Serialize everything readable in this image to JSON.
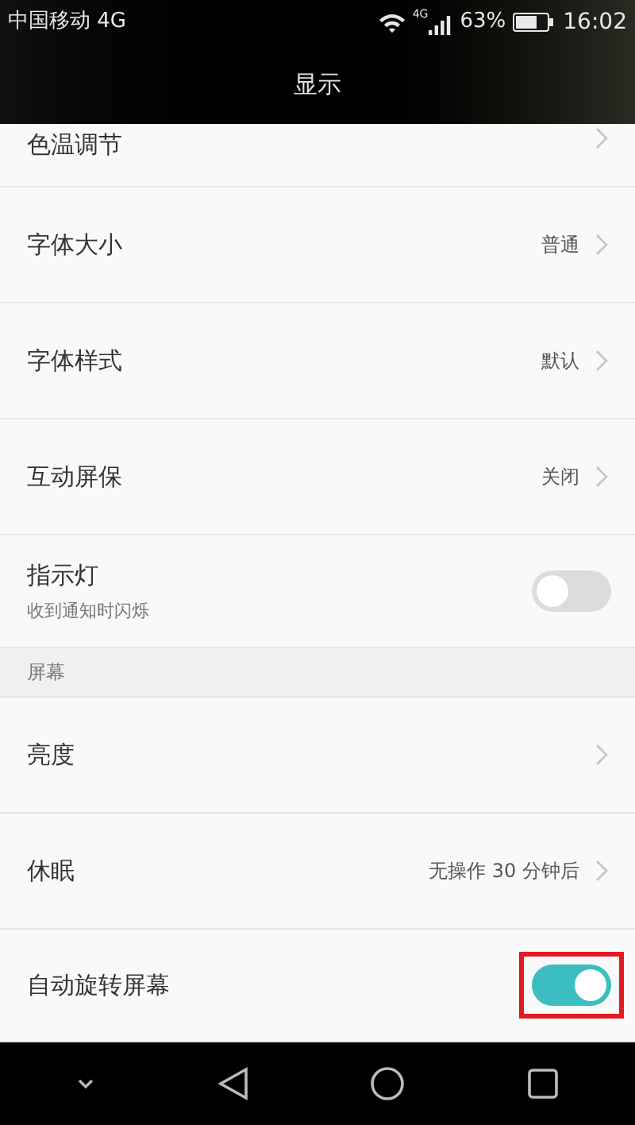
{
  "status_bar": {
    "carrier": "中国移动 4G",
    "network_badge": "4G",
    "battery": "63%",
    "time": "16:02"
  },
  "header": {
    "title": "显示"
  },
  "rows": [
    {
      "kind": "link",
      "label": "色温调节",
      "partial": true
    },
    {
      "kind": "link",
      "label": "字体大小",
      "value": "普通"
    },
    {
      "kind": "link",
      "label": "字体样式",
      "value": "默认"
    },
    {
      "kind": "link",
      "label": "互动屏保",
      "value": "关闭"
    },
    {
      "kind": "toggle",
      "label": "指示灯",
      "subtitle": "收到通知时闪烁",
      "on": false,
      "highlighted": false
    },
    {
      "kind": "section",
      "label": "屏幕"
    },
    {
      "kind": "link",
      "label": "亮度"
    },
    {
      "kind": "link",
      "label": "休眠",
      "value": "无操作 30 分钟后"
    },
    {
      "kind": "toggle",
      "label": "自动旋转屏幕",
      "on": true,
      "highlighted": true
    }
  ]
}
